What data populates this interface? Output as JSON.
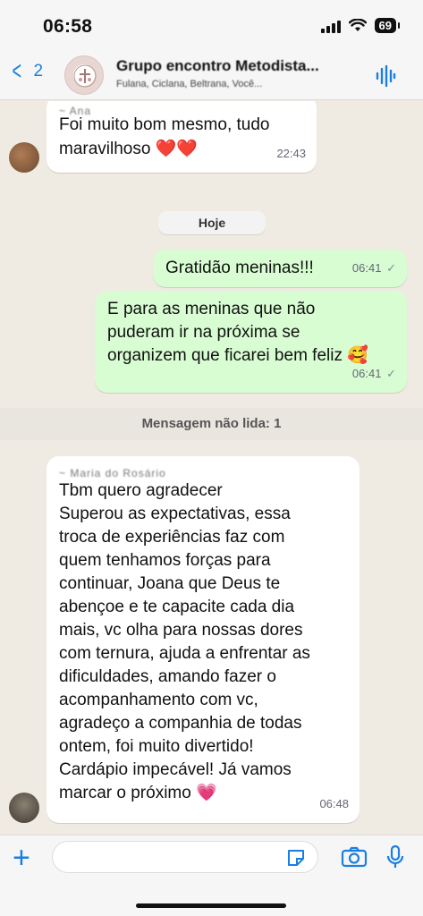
{
  "status": {
    "time": "06:58",
    "battery": "69"
  },
  "header": {
    "back_count": "2",
    "title": "Grupo encontro Metodista...",
    "subtitle": "Fulana, Ciclana, Beltrana, Você..."
  },
  "messages": [
    {
      "sender": "~ Ana",
      "text_lines": [
        "Foi muito bom mesmo, tudo",
        "maravilhoso ❤️❤️"
      ],
      "time": "22:43"
    },
    {
      "text": "Gratidão meninas!!!",
      "time": "06:41"
    },
    {
      "text_lines": [
        "E para as meninas que não",
        "puderam ir na próxima se",
        "organizem que ficarei bem feliz 🥰"
      ],
      "time": "06:41"
    },
    {
      "sender": "~ Maria do Rosário",
      "text_lines": [
        "Tbm quero agradecer",
        "Superou as expectativas, essa",
        "troca de experiências faz com",
        "quem tenhamos forças para",
        "continuar, Joana que Deus te",
        "abençoe e te capacite cada dia",
        "mais, vc olha para nossas dores",
        "com ternura, ajuda a enfrentar as",
        "dificuldades, amando fazer o",
        "acompanhamento com vc,",
        "agradeço a companhia de todas",
        "ontem, foi muito divertido!",
        "Cardápio impecável! Já vamos",
        "marcar o próximo 💗"
      ],
      "time": "06:48"
    }
  ],
  "date_chip": "Hoje",
  "unread_label": "Mensagem não lida: 1",
  "input": {
    "placeholder": ""
  },
  "icons": [
    "back-chevron-icon",
    "group-avatar",
    "voice-wave-icon",
    "plus-icon",
    "sticker-icon",
    "camera-icon",
    "mic-icon"
  ],
  "colors": {
    "accent": "#1a7fe0",
    "outgoing_bubble": "#d9fdd3",
    "incoming_bubble": "#ffffff",
    "chat_bg": "#efeae2"
  }
}
